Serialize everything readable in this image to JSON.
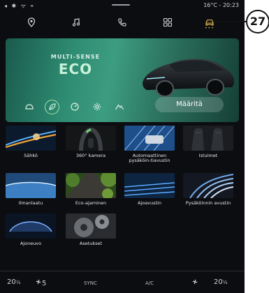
{
  "status_bar": {
    "left_icons": "◂ ✱ ᯤ ⌖",
    "temperature": "16°C",
    "separator": "-",
    "time": "20:23"
  },
  "nav": {
    "items": [
      {
        "icon": "location-icon",
        "active": false
      },
      {
        "icon": "music-icon",
        "active": false
      },
      {
        "icon": "phone-icon",
        "active": false
      },
      {
        "icon": "apps-grid-icon",
        "active": false
      },
      {
        "icon": "car-icon",
        "active": true
      }
    ],
    "accent_color": "#d8b04a"
  },
  "hero": {
    "subtitle": "MULTI-SENSE",
    "title": "ECO",
    "modes": [
      "comfort-icon",
      "eco-leaf-icon",
      "sport-icon",
      "settings-gear-icon",
      "mountain-icon"
    ],
    "selected_mode": "eco-leaf-icon",
    "configure_label": "Määritä"
  },
  "tiles": [
    {
      "label": "Sähkö",
      "name": "electric"
    },
    {
      "label": "360° kamera",
      "name": "camera-360"
    },
    {
      "label": "Automaattinen pysäköin-tiavustin",
      "name": "auto-park-assist"
    },
    {
      "label": "Istuimet",
      "name": "seats"
    },
    {
      "label": "Ilmanlaatu",
      "name": "air-quality"
    },
    {
      "label": "Eco-ajaminen",
      "name": "eco-driving"
    },
    {
      "label": "Ajoavustin",
      "name": "driving-assist"
    },
    {
      "label": "Pysäköinnin avustin",
      "name": "parking-assist"
    },
    {
      "label": "Ajoneuvo",
      "name": "vehicle"
    },
    {
      "label": "Asetukset",
      "name": "settings"
    }
  ],
  "bottom_bar": {
    "left_temp": "20",
    "left_temp_unit": "½",
    "fan_speed": "5",
    "sync": "SYNC",
    "ac": "A/C",
    "right_temp": "20",
    "right_temp_unit": "½"
  },
  "callout": {
    "number": "27"
  }
}
